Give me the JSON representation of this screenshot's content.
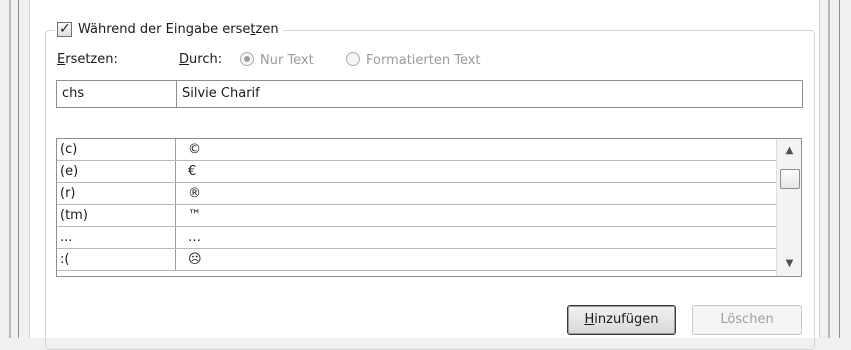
{
  "replace_while_typing": {
    "label": "Während der Eingabe ersetzen",
    "checked": true
  },
  "replace_label": "Ersetzen:",
  "with_label": "Durch:",
  "options": {
    "plain_text": {
      "label": "Nur Text",
      "selected": true
    },
    "formatted_text": {
      "label": "Formatierten Text",
      "selected": false
    }
  },
  "replace_input": {
    "value": "chs"
  },
  "with_input": {
    "value": "Silvie Charif"
  },
  "list_rows": [
    {
      "replace": "(c)",
      "with": "©"
    },
    {
      "replace": "(e)",
      "with": "€"
    },
    {
      "replace": "(r)",
      "with": "®"
    },
    {
      "replace": "(tm)",
      "with": "™"
    },
    {
      "replace": "...",
      "with": "…"
    },
    {
      "replace": ":(",
      "with": "☹"
    }
  ],
  "buttons": {
    "add": "Hinzufügen",
    "delete": "Löschen"
  },
  "scrollbar": {
    "up": "▲",
    "down": "▼"
  },
  "colors": {
    "frame": "#b7b7b7",
    "border": "#8f8f8f",
    "disabled_text": "#9a9a9a"
  }
}
